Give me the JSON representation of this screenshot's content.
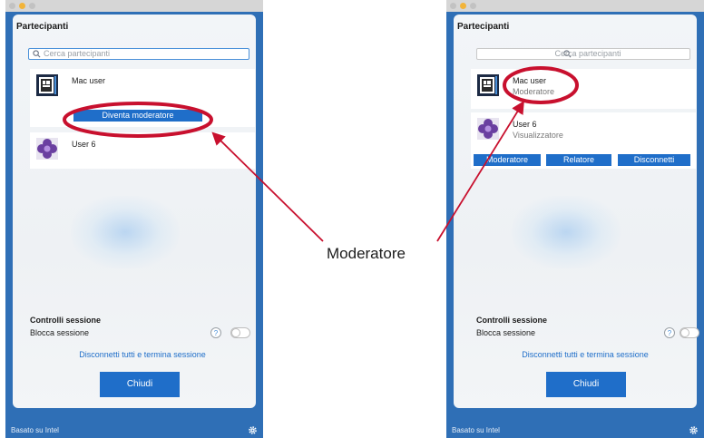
{
  "callout": {
    "label": "Moderatore",
    "color": "#c8102e"
  },
  "left": {
    "title": "Partecipanti",
    "search_placeholder": "Cerca partecipanti",
    "users": [
      {
        "name": "Mac user",
        "action": "Diventa moderatore"
      },
      {
        "name": "User 6"
      }
    ],
    "controls_title": "Controlli sessione",
    "lock_label": "Blocca sessione",
    "help": "?",
    "end_link": "Disconnetti tutti e termina sessione",
    "close_label": "Chiudi",
    "footer": "Basato su Intel"
  },
  "right": {
    "title": "Partecipanti",
    "search_placeholder": "Cerca partecipanti",
    "users": [
      {
        "name": "Mac user",
        "role": "Moderatore"
      },
      {
        "name": "User 6",
        "role": "Visualizzatore",
        "actions": [
          "Moderatore",
          "Relatore",
          "Disconnetti"
        ]
      }
    ],
    "controls_title": "Controlli sessione",
    "lock_label": "Blocca sessione",
    "help": "?",
    "end_link": "Disconnetti tutti e termina sessione",
    "close_label": "Chiudi",
    "footer": "Basato su Intel"
  },
  "colors": {
    "accent": "#1f6ec9",
    "frame": "#2f6fb6",
    "annotation": "#c8102e"
  },
  "icons": {
    "search": "magnifier-icon",
    "settings": "gear-icon",
    "mac_avatar": "mac-user-avatar",
    "user6_avatar": "flower-avatar"
  }
}
